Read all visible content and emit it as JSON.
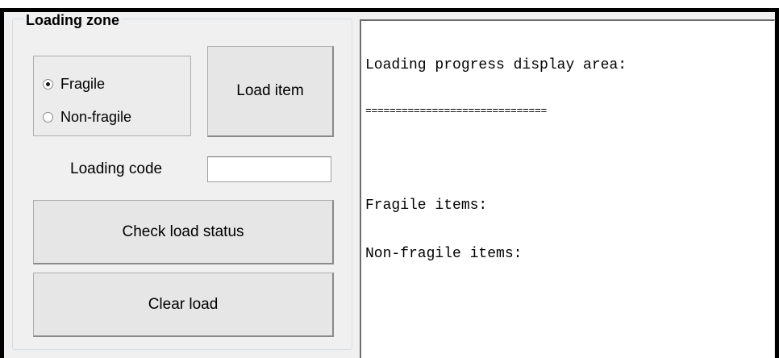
{
  "loading_zone": {
    "title": "Loading zone",
    "radio_options": [
      {
        "label": "Fragile",
        "checked": true
      },
      {
        "label": "Non-fragile",
        "checked": false
      }
    ],
    "load_item_button": "Load item",
    "loading_code_label": "Loading code",
    "loading_code_value": "",
    "check_status_button": "Check load status",
    "clear_button": "Clear load"
  },
  "display": {
    "lines": [
      "Loading progress display area:",
      "==============================",
      "",
      "Fragile items:",
      "Non-fragile items:"
    ]
  }
}
